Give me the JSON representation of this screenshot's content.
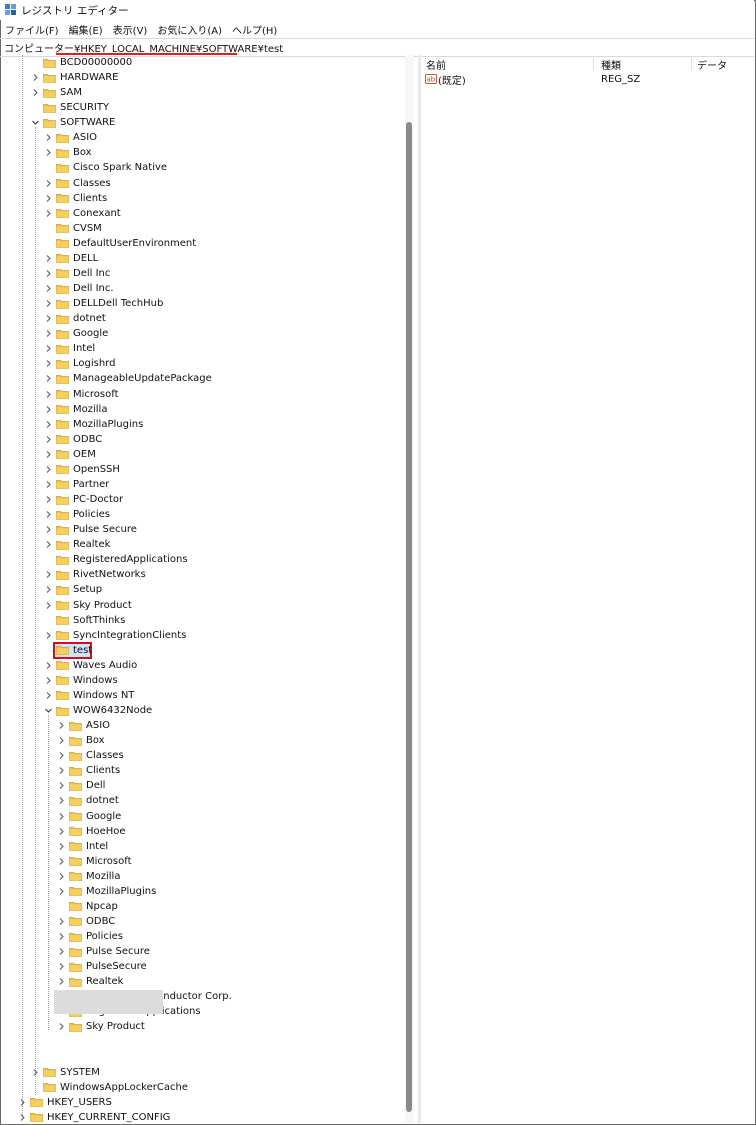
{
  "window": {
    "title": "レジストリ エディター"
  },
  "menu": [
    "ファイル(F)",
    "編集(E)",
    "表示(V)",
    "お気に入り(A)",
    "ヘルプ(H)"
  ],
  "address": {
    "path": "コンピューター¥HKEY_LOCAL_MACHINE¥SOFTWARE¥test"
  },
  "tree": {
    "rows": [
      {
        "label": "BCD00000000",
        "expander": "none"
      },
      {
        "label": "HARDWARE",
        "expander": "collapsed"
      },
      {
        "label": "SAM",
        "expander": "collapsed"
      },
      {
        "label": "SECURITY",
        "expander": "none"
      },
      {
        "label": "SOFTWARE",
        "expander": "expanded"
      },
      {
        "label": "ASIO",
        "expander": "collapsed"
      },
      {
        "label": "Box",
        "expander": "collapsed"
      },
      {
        "label": "Cisco Spark Native",
        "expander": "none"
      },
      {
        "label": "Classes",
        "expander": "collapsed"
      },
      {
        "label": "Clients",
        "expander": "collapsed"
      },
      {
        "label": "Conexant",
        "expander": "collapsed"
      },
      {
        "label": "CVSM",
        "expander": "none"
      },
      {
        "label": "DefaultUserEnvironment",
        "expander": "none"
      },
      {
        "label": "DELL",
        "expander": "collapsed"
      },
      {
        "label": "Dell Inc",
        "expander": "collapsed"
      },
      {
        "label": "Dell Inc.",
        "expander": "collapsed"
      },
      {
        "label": "DELLDell TechHub",
        "expander": "collapsed"
      },
      {
        "label": "dotnet",
        "expander": "collapsed"
      },
      {
        "label": "Google",
        "expander": "collapsed"
      },
      {
        "label": "Intel",
        "expander": "collapsed"
      },
      {
        "label": "Logishrd",
        "expander": "collapsed"
      },
      {
        "label": "ManageableUpdatePackage",
        "expander": "collapsed"
      },
      {
        "label": "Microsoft",
        "expander": "collapsed"
      },
      {
        "label": "Mozilla",
        "expander": "collapsed"
      },
      {
        "label": "MozillaPlugins",
        "expander": "collapsed"
      },
      {
        "label": "ODBC",
        "expander": "collapsed"
      },
      {
        "label": "OEM",
        "expander": "collapsed"
      },
      {
        "label": "OpenSSH",
        "expander": "collapsed"
      },
      {
        "label": "Partner",
        "expander": "collapsed"
      },
      {
        "label": "PC-Doctor",
        "expander": "collapsed"
      },
      {
        "label": "Policies",
        "expander": "collapsed"
      },
      {
        "label": "Pulse Secure",
        "expander": "collapsed"
      },
      {
        "label": "Realtek",
        "expander": "collapsed"
      },
      {
        "label": "RegisteredApplications",
        "expander": "none"
      },
      {
        "label": "RivetNetworks",
        "expander": "collapsed"
      },
      {
        "label": "Setup",
        "expander": "collapsed"
      },
      {
        "label": "Sky Product",
        "expander": "collapsed"
      },
      {
        "label": "SoftThinks",
        "expander": "none"
      },
      {
        "label": "SyncIntegrationClients",
        "expander": "collapsed"
      },
      {
        "label": "test",
        "expander": "none",
        "selected": true
      },
      {
        "label": "Waves Audio",
        "expander": "collapsed"
      },
      {
        "label": "Windows",
        "expander": "collapsed"
      },
      {
        "label": "Windows NT",
        "expander": "collapsed"
      },
      {
        "label": "WOW6432Node",
        "expander": "expanded"
      },
      {
        "label": "ASIO",
        "expander": "collapsed"
      },
      {
        "label": "Box",
        "expander": "collapsed"
      },
      {
        "label": "Classes",
        "expander": "collapsed"
      },
      {
        "label": "Clients",
        "expander": "collapsed"
      },
      {
        "label": "Dell",
        "expander": "collapsed"
      },
      {
        "label": "dotnet",
        "expander": "collapsed"
      },
      {
        "label": "Google",
        "expander": "collapsed"
      },
      {
        "label": "HoeHoe",
        "expander": "collapsed"
      },
      {
        "label": "Intel",
        "expander": "collapsed"
      },
      {
        "label": "Microsoft",
        "expander": "collapsed"
      },
      {
        "label": "Mozilla",
        "expander": "collapsed"
      },
      {
        "label": "MozillaPlugins",
        "expander": "collapsed"
      },
      {
        "label": "Npcap",
        "expander": "none"
      },
      {
        "label": "ODBC",
        "expander": "collapsed"
      },
      {
        "label": "Policies",
        "expander": "collapsed"
      },
      {
        "label": "Pulse Secure",
        "expander": "collapsed"
      },
      {
        "label": "PulseSecure",
        "expander": "collapsed"
      },
      {
        "label": "Realtek",
        "expander": "collapsed"
      },
      {
        "label": "Realtek Semiconductor Corp.",
        "expander": "collapsed"
      },
      {
        "label": "RegisteredApplications",
        "expander": "none"
      },
      {
        "label": "Sky Product",
        "expander": "collapsed"
      },
      {
        "label": "SYSTEM",
        "expander": "collapsed"
      },
      {
        "label": "WindowsAppLockerCache",
        "expander": "none"
      },
      {
        "label": "HKEY_USERS",
        "expander": "collapsed"
      },
      {
        "label": "HKEY_CURRENT_CONFIG",
        "expander": "collapsed"
      }
    ]
  },
  "list": {
    "columns": [
      "名前",
      "種類",
      "データ"
    ],
    "rows": [
      {
        "name": "(既定)",
        "type": "REG_SZ",
        "data": ""
      }
    ]
  },
  "colors": {
    "selection": "#cce4f7",
    "highlight": "#d01020",
    "folder": "#f2c14e"
  }
}
